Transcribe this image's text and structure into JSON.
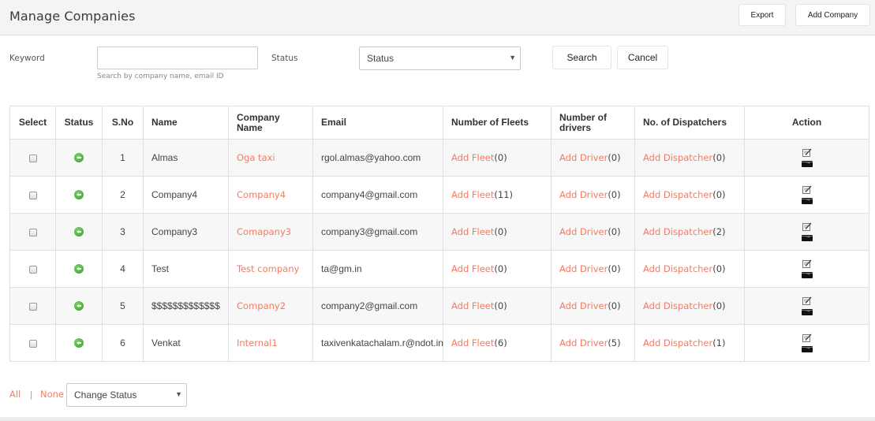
{
  "header": {
    "title": "Manage Companies",
    "export_label": "Export",
    "add_company_label": "Add Company"
  },
  "filters": {
    "keyword_label": "Keyword",
    "keyword_value": "",
    "keyword_placeholder": "",
    "keyword_help": "Search by company name, email ID",
    "status_label": "Status",
    "status_selected": "Status",
    "search_label": "Search",
    "cancel_label": "Cancel"
  },
  "table": {
    "columns": [
      "Select",
      "Status",
      "S.No",
      "Name",
      "Company Name",
      "Email",
      "Number of Fleets",
      "Number of drivers",
      "No. of Dispatchers",
      "Action"
    ],
    "link_labels": {
      "fleet": "Add Fleet",
      "driver": "Add Driver",
      "dispatcher": "Add Dispatcher"
    },
    "rows": [
      {
        "sno": "1",
        "name": "Almas",
        "company": "Oga taxi",
        "email": "rgol.almas@yahoo.com",
        "fleets": "(0)",
        "drivers": "(0)",
        "dispatchers": "(0)",
        "status": "active"
      },
      {
        "sno": "2",
        "name": "Company4",
        "company": "Company4",
        "email": "company4@gmail.com",
        "fleets": "(11)",
        "drivers": "(0)",
        "dispatchers": "(0)",
        "status": "active"
      },
      {
        "sno": "3",
        "name": "Company3",
        "company": "Comapany3",
        "email": "company3@gmail.com",
        "fleets": "(0)",
        "drivers": "(0)",
        "dispatchers": "(2)",
        "status": "active"
      },
      {
        "sno": "4",
        "name": "Test",
        "company": "Test company",
        "email": "ta@gm.in",
        "fleets": "(0)",
        "drivers": "(0)",
        "dispatchers": "(0)",
        "status": "active"
      },
      {
        "sno": "5",
        "name": "$$$$$$$$$$$$$",
        "company": "Company2",
        "email": "company2@gmail.com",
        "fleets": "(0)",
        "drivers": "(0)",
        "dispatchers": "(0)",
        "status": "active"
      },
      {
        "sno": "6",
        "name": "Venkat",
        "company": "Internal1",
        "email": "taxivenkatachalam.r@ndot.in",
        "fleets": "(6)",
        "drivers": "(5)",
        "dispatchers": "(1)",
        "status": "active"
      }
    ]
  },
  "footer": {
    "all_label": "All",
    "separator": "|",
    "none_label": "None",
    "change_status_selected": "Change Status"
  },
  "colors": {
    "link": "#f47b63",
    "status_active": "#4caf3a"
  }
}
